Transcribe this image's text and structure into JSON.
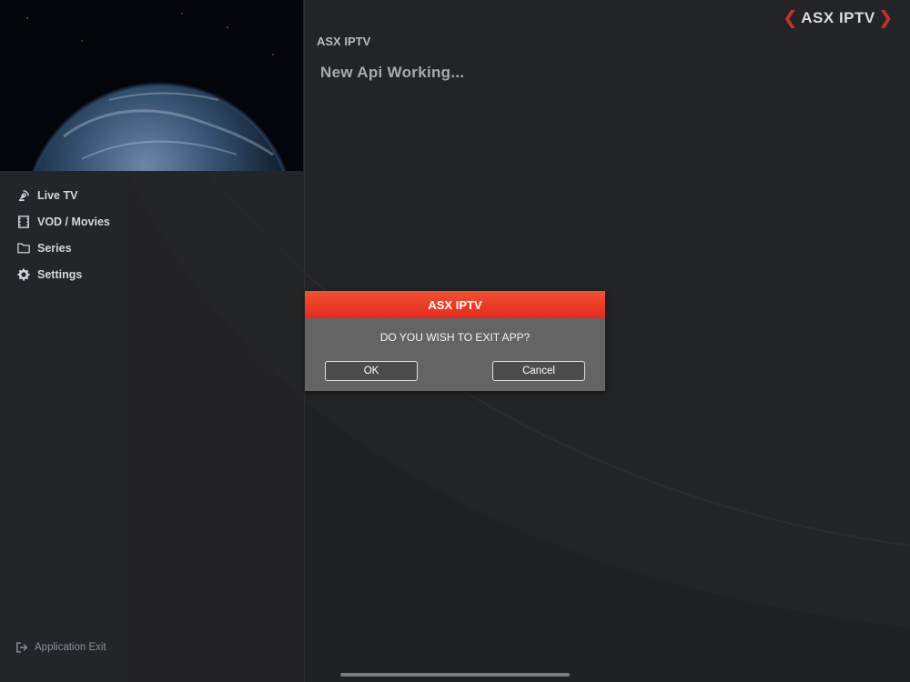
{
  "app": {
    "brand": "ASX IPTV",
    "section_title": "ASX IPTV",
    "status": "New Api Working..."
  },
  "sidebar": {
    "items": [
      {
        "label": "Live TV",
        "icon": "satellite-dish-icon"
      },
      {
        "label": "VOD / Movies",
        "icon": "film-icon"
      },
      {
        "label": "Series",
        "icon": "folder-icon"
      },
      {
        "label": "Settings",
        "icon": "gear-icon"
      }
    ],
    "exit_label": "Application Exit"
  },
  "dialog": {
    "title": "ASX IPTV",
    "message": "DO YOU WISH TO EXIT APP?",
    "ok_label": "OK",
    "cancel_label": "Cancel"
  },
  "colors": {
    "accent": "#e8311f",
    "background": "#232426",
    "dialog_body": "#646464"
  }
}
